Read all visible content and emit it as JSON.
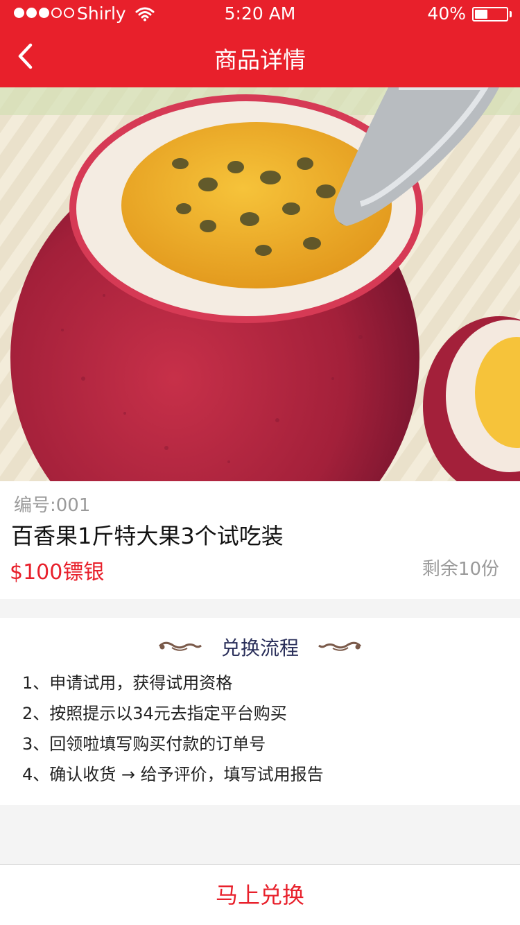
{
  "status_bar": {
    "carrier": "Shirly",
    "time": "5:20 AM",
    "battery_percent": "40%",
    "battery_level": 0.4,
    "signal_bars_filled": 3,
    "signal_bars_total": 5
  },
  "nav": {
    "title": "商品详情",
    "back_icon": "chevron-left-icon"
  },
  "carousel": {
    "image_subject": "passion fruit",
    "page_count": 5,
    "active_index": 0
  },
  "product": {
    "sku": "编号:001",
    "name": "百香果1斤特大果3个试吃装",
    "price": "$100镖银",
    "stock": "剩余10份"
  },
  "process": {
    "title": "兑换流程",
    "steps": [
      "1、申请试用，获得试用资格",
      "2、按照提示以34元去指定平台购买",
      "3、回领啦填写购买付款的订单号",
      "4、确认收货 → 给予评价，填写试用报告"
    ]
  },
  "footer": {
    "exchange_label": "马上兑换"
  },
  "colors": {
    "brand_red": "#e8202b",
    "title_navy": "#2a2f5a",
    "flourish_brown": "#7a5a4a"
  }
}
